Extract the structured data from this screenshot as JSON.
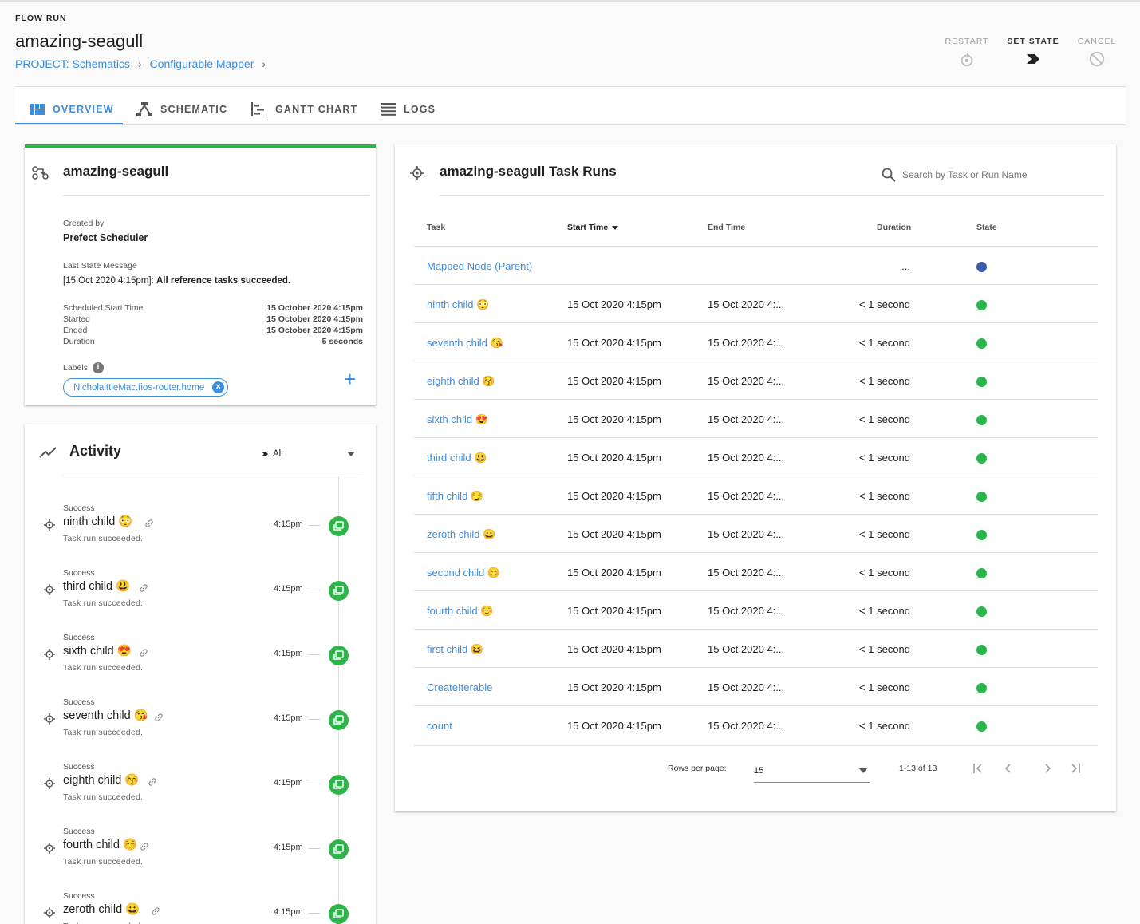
{
  "header": {
    "section_label": "FLOW RUN",
    "title": "amazing-seagull",
    "breadcrumbs": [
      "PROJECT: Schematics",
      "Configurable Mapper"
    ],
    "actions": {
      "restart": "RESTART",
      "set_state": "SET STATE",
      "cancel": "CANCEL"
    }
  },
  "tabs": [
    {
      "label": "OVERVIEW",
      "icon": "overview-icon",
      "active": true
    },
    {
      "label": "SCHEMATIC",
      "icon": "schematic-icon",
      "active": false
    },
    {
      "label": "GANTT CHART",
      "icon": "gantt-icon",
      "active": false
    },
    {
      "label": "LOGS",
      "icon": "logs-icon",
      "active": false
    }
  ],
  "details": {
    "title": "amazing-seagull",
    "created_by_label": "Created by",
    "created_by": "Prefect Scheduler",
    "last_state_label": "Last State Message",
    "last_state_time": "[15 Oct 2020 4:15pm]:",
    "last_state_message": "All reference tasks succeeded.",
    "fields": [
      {
        "label": "Scheduled Start Time",
        "value": "15 October 2020 4:15pm"
      },
      {
        "label": "Started",
        "value": "15 October 2020 4:15pm"
      },
      {
        "label": "Ended",
        "value": "15 October 2020 4:15pm"
      },
      {
        "label": "Duration",
        "value": "5 seconds"
      }
    ],
    "labels_label": "Labels",
    "label_chip": "NicholaittleMac.fios-router.home",
    "status_color": "#2db54a"
  },
  "activity": {
    "title": "Activity",
    "filter": "All",
    "items": [
      {
        "status": "Success",
        "name": "ninth child 😳",
        "message": "Task run succeeded.",
        "time": "4:15pm"
      },
      {
        "status": "Success",
        "name": "third child 😃",
        "message": "Task run succeeded.",
        "time": "4:15pm"
      },
      {
        "status": "Success",
        "name": "sixth child 😍",
        "message": "Task run succeeded.",
        "time": "4:15pm"
      },
      {
        "status": "Success",
        "name": "seventh child 😘",
        "message": "Task run succeeded.",
        "time": "4:15pm"
      },
      {
        "status": "Success",
        "name": "eighth child 😚",
        "message": "Task run succeeded.",
        "time": "4:15pm"
      },
      {
        "status": "Success",
        "name": "fourth child ☺️",
        "message": "Task run succeeded.",
        "time": "4:15pm"
      },
      {
        "status": "Success",
        "name": "zeroth child 😀",
        "message": "Task run succeeded.",
        "time": "4:15pm"
      }
    ]
  },
  "task_runs": {
    "title": "amazing-seagull Task Runs",
    "search_placeholder": "Search by Task or Run Name",
    "columns": {
      "task": "Task",
      "start": "Start Time",
      "end": "End Time",
      "duration": "Duration",
      "state": "State"
    },
    "rows": [
      {
        "task": "Mapped Node (Parent)",
        "start": "",
        "end": "",
        "duration": "...",
        "state_color": "#3a5bab"
      },
      {
        "task": "ninth child 😳",
        "start": "15 Oct 2020 4:15pm",
        "end": "15 Oct 2020 4:...",
        "duration": "< 1 second",
        "state_color": "#2db54a"
      },
      {
        "task": "seventh child 😘",
        "start": "15 Oct 2020 4:15pm",
        "end": "15 Oct 2020 4:...",
        "duration": "< 1 second",
        "state_color": "#2db54a"
      },
      {
        "task": "eighth child 😚",
        "start": "15 Oct 2020 4:15pm",
        "end": "15 Oct 2020 4:...",
        "duration": "< 1 second",
        "state_color": "#2db54a"
      },
      {
        "task": "sixth child 😍",
        "start": "15 Oct 2020 4:15pm",
        "end": "15 Oct 2020 4:...",
        "duration": "< 1 second",
        "state_color": "#2db54a"
      },
      {
        "task": "third child 😃",
        "start": "15 Oct 2020 4:15pm",
        "end": "15 Oct 2020 4:...",
        "duration": "< 1 second",
        "state_color": "#2db54a"
      },
      {
        "task": "fifth child 😏",
        "start": "15 Oct 2020 4:15pm",
        "end": "15 Oct 2020 4:...",
        "duration": "< 1 second",
        "state_color": "#2db54a"
      },
      {
        "task": "zeroth child 😀",
        "start": "15 Oct 2020 4:15pm",
        "end": "15 Oct 2020 4:...",
        "duration": "< 1 second",
        "state_color": "#2db54a"
      },
      {
        "task": "second child 😊",
        "start": "15 Oct 2020 4:15pm",
        "end": "15 Oct 2020 4:...",
        "duration": "< 1 second",
        "state_color": "#2db54a"
      },
      {
        "task": "fourth child ☺️",
        "start": "15 Oct 2020 4:15pm",
        "end": "15 Oct 2020 4:...",
        "duration": "< 1 second",
        "state_color": "#2db54a"
      },
      {
        "task": "first child 😆",
        "start": "15 Oct 2020 4:15pm",
        "end": "15 Oct 2020 4:...",
        "duration": "< 1 second",
        "state_color": "#2db54a"
      },
      {
        "task": "CreateIterable",
        "start": "15 Oct 2020 4:15pm",
        "end": "15 Oct 2020 4:...",
        "duration": "< 1 second",
        "state_color": "#2db54a"
      },
      {
        "task": "count",
        "start": "15 Oct 2020 4:15pm",
        "end": "15 Oct 2020 4:...",
        "duration": "< 1 second",
        "state_color": "#2db54a"
      }
    ],
    "pagination": {
      "rows_per_page_label": "Rows per page:",
      "rows_per_page": "15",
      "range": "1-13 of 13"
    }
  },
  "colors": {
    "accent": "#3b8dde",
    "success": "#2db54a",
    "running": "#3a5bab"
  }
}
